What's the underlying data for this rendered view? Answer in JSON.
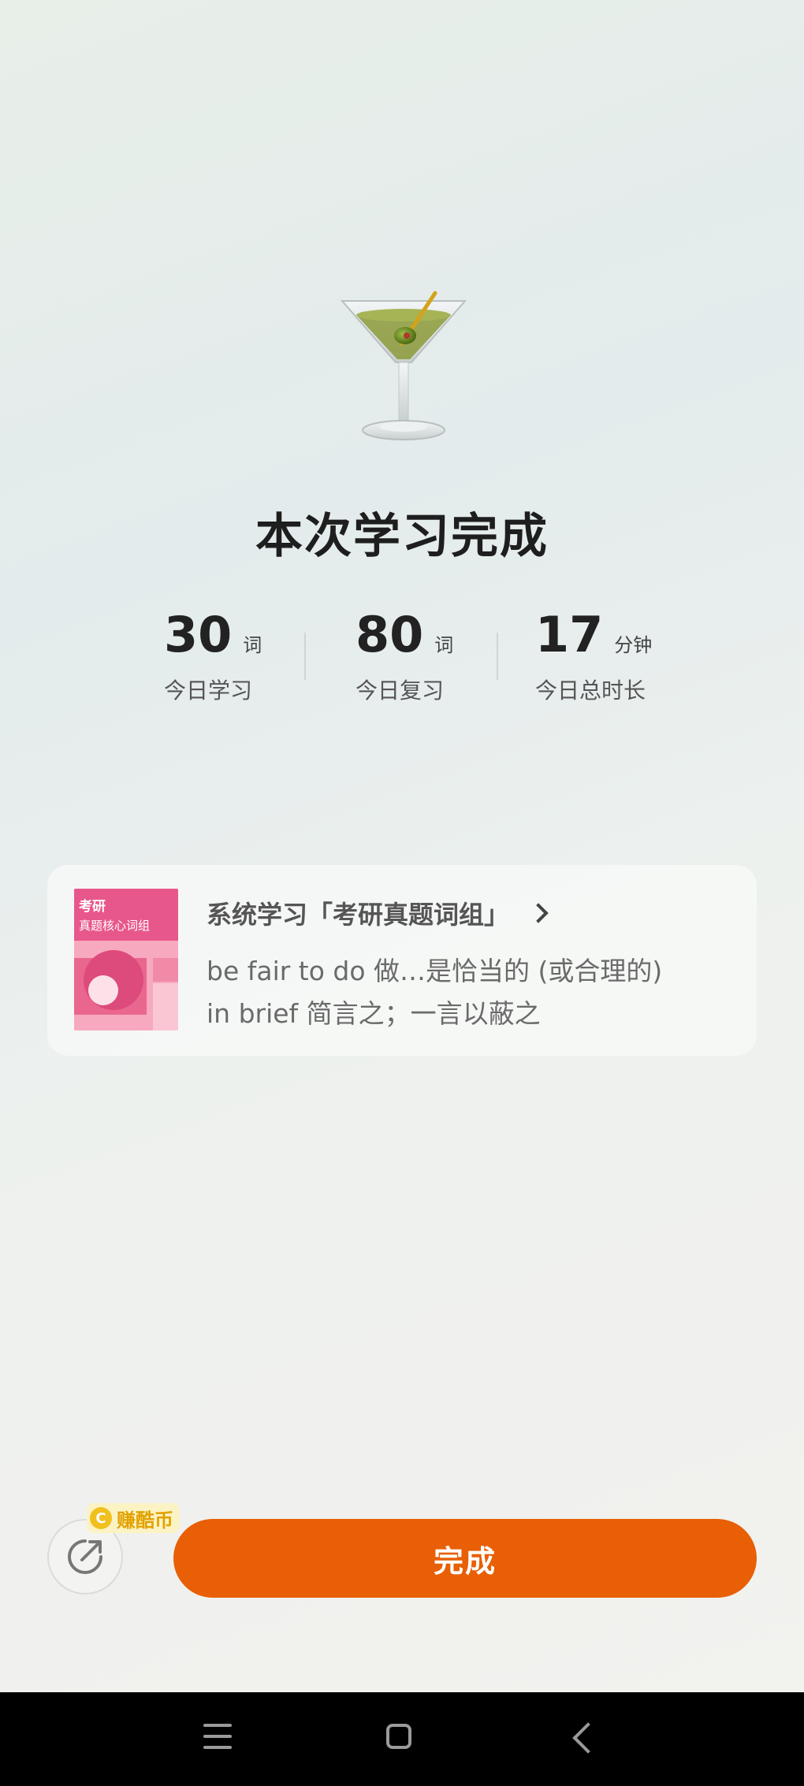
{
  "hero": {
    "icon": "cocktail-glass-icon"
  },
  "title": "本次学习完成",
  "stats": [
    {
      "value": "30",
      "unit": "词",
      "label": "今日学习"
    },
    {
      "value": "80",
      "unit": "词",
      "label": "今日复习"
    },
    {
      "value": "17",
      "unit": "分钟",
      "label": "今日总时长"
    }
  ],
  "card": {
    "book": {
      "title": "考研",
      "subtitle": "真题核心词组"
    },
    "heading": "系统学习「考研真题词组」",
    "lines": [
      "be fair to do 做…是恰当的 (或合理的)",
      "in brief 简言之；一言以蔽之"
    ]
  },
  "actions": {
    "coin_badge": "赚酷币",
    "coin_symbol": "C",
    "done_label": "完成",
    "accent_color": "#e85f05"
  },
  "navbar": {
    "icons": [
      "menu-icon",
      "home-icon",
      "back-icon"
    ]
  }
}
